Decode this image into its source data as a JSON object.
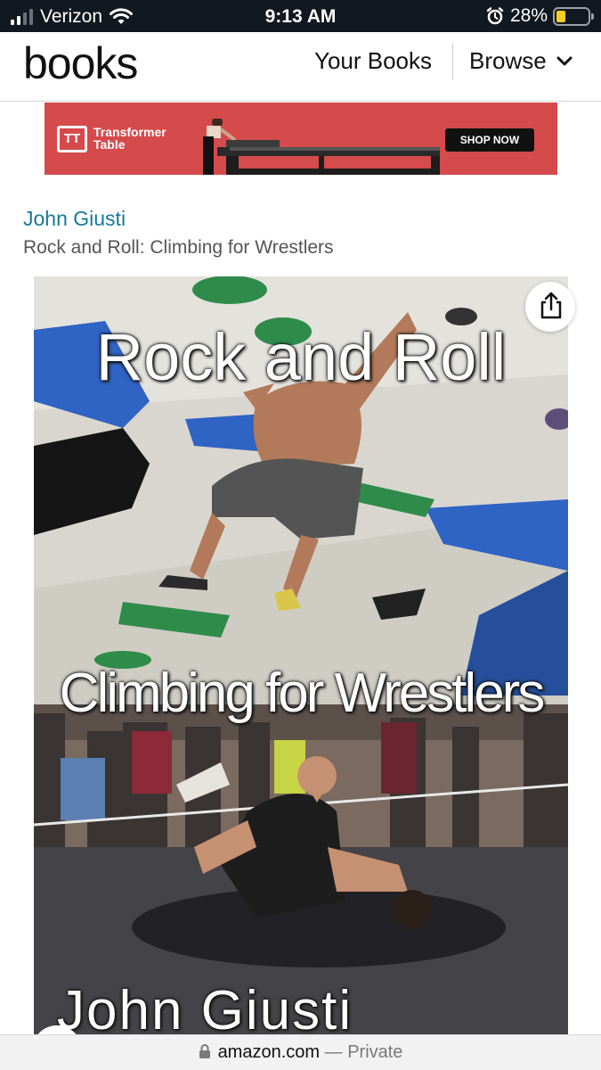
{
  "status_bar": {
    "carrier": "Verizon",
    "time": "9:13 AM",
    "battery": "28%",
    "battery_level": 0.28,
    "icons": [
      "signal-icon",
      "wifi-icon",
      "alarm-icon",
      "battery-icon"
    ]
  },
  "header": {
    "logo": "books",
    "nav": {
      "your_books": "Your Books",
      "browse": "Browse"
    }
  },
  "ad": {
    "brand_line1": "Transformer",
    "brand_line2": "Table",
    "logo_mark": "TT",
    "cta": "SHOP NOW",
    "background": "#d54a4b"
  },
  "book": {
    "author": "John Giusti",
    "title": "Rock and Roll: Climbing for Wrestlers",
    "cover": {
      "title": "Rock and Roll",
      "subtitle": "Climbing for Wrestlers",
      "author": "John Giusti"
    }
  },
  "url_bar": {
    "domain": "amazon.com",
    "separator": "—",
    "mode": "Private"
  },
  "colors": {
    "link": "#16789a",
    "status_bar_bg": "#121820",
    "battery_fill": "#f5d020"
  }
}
